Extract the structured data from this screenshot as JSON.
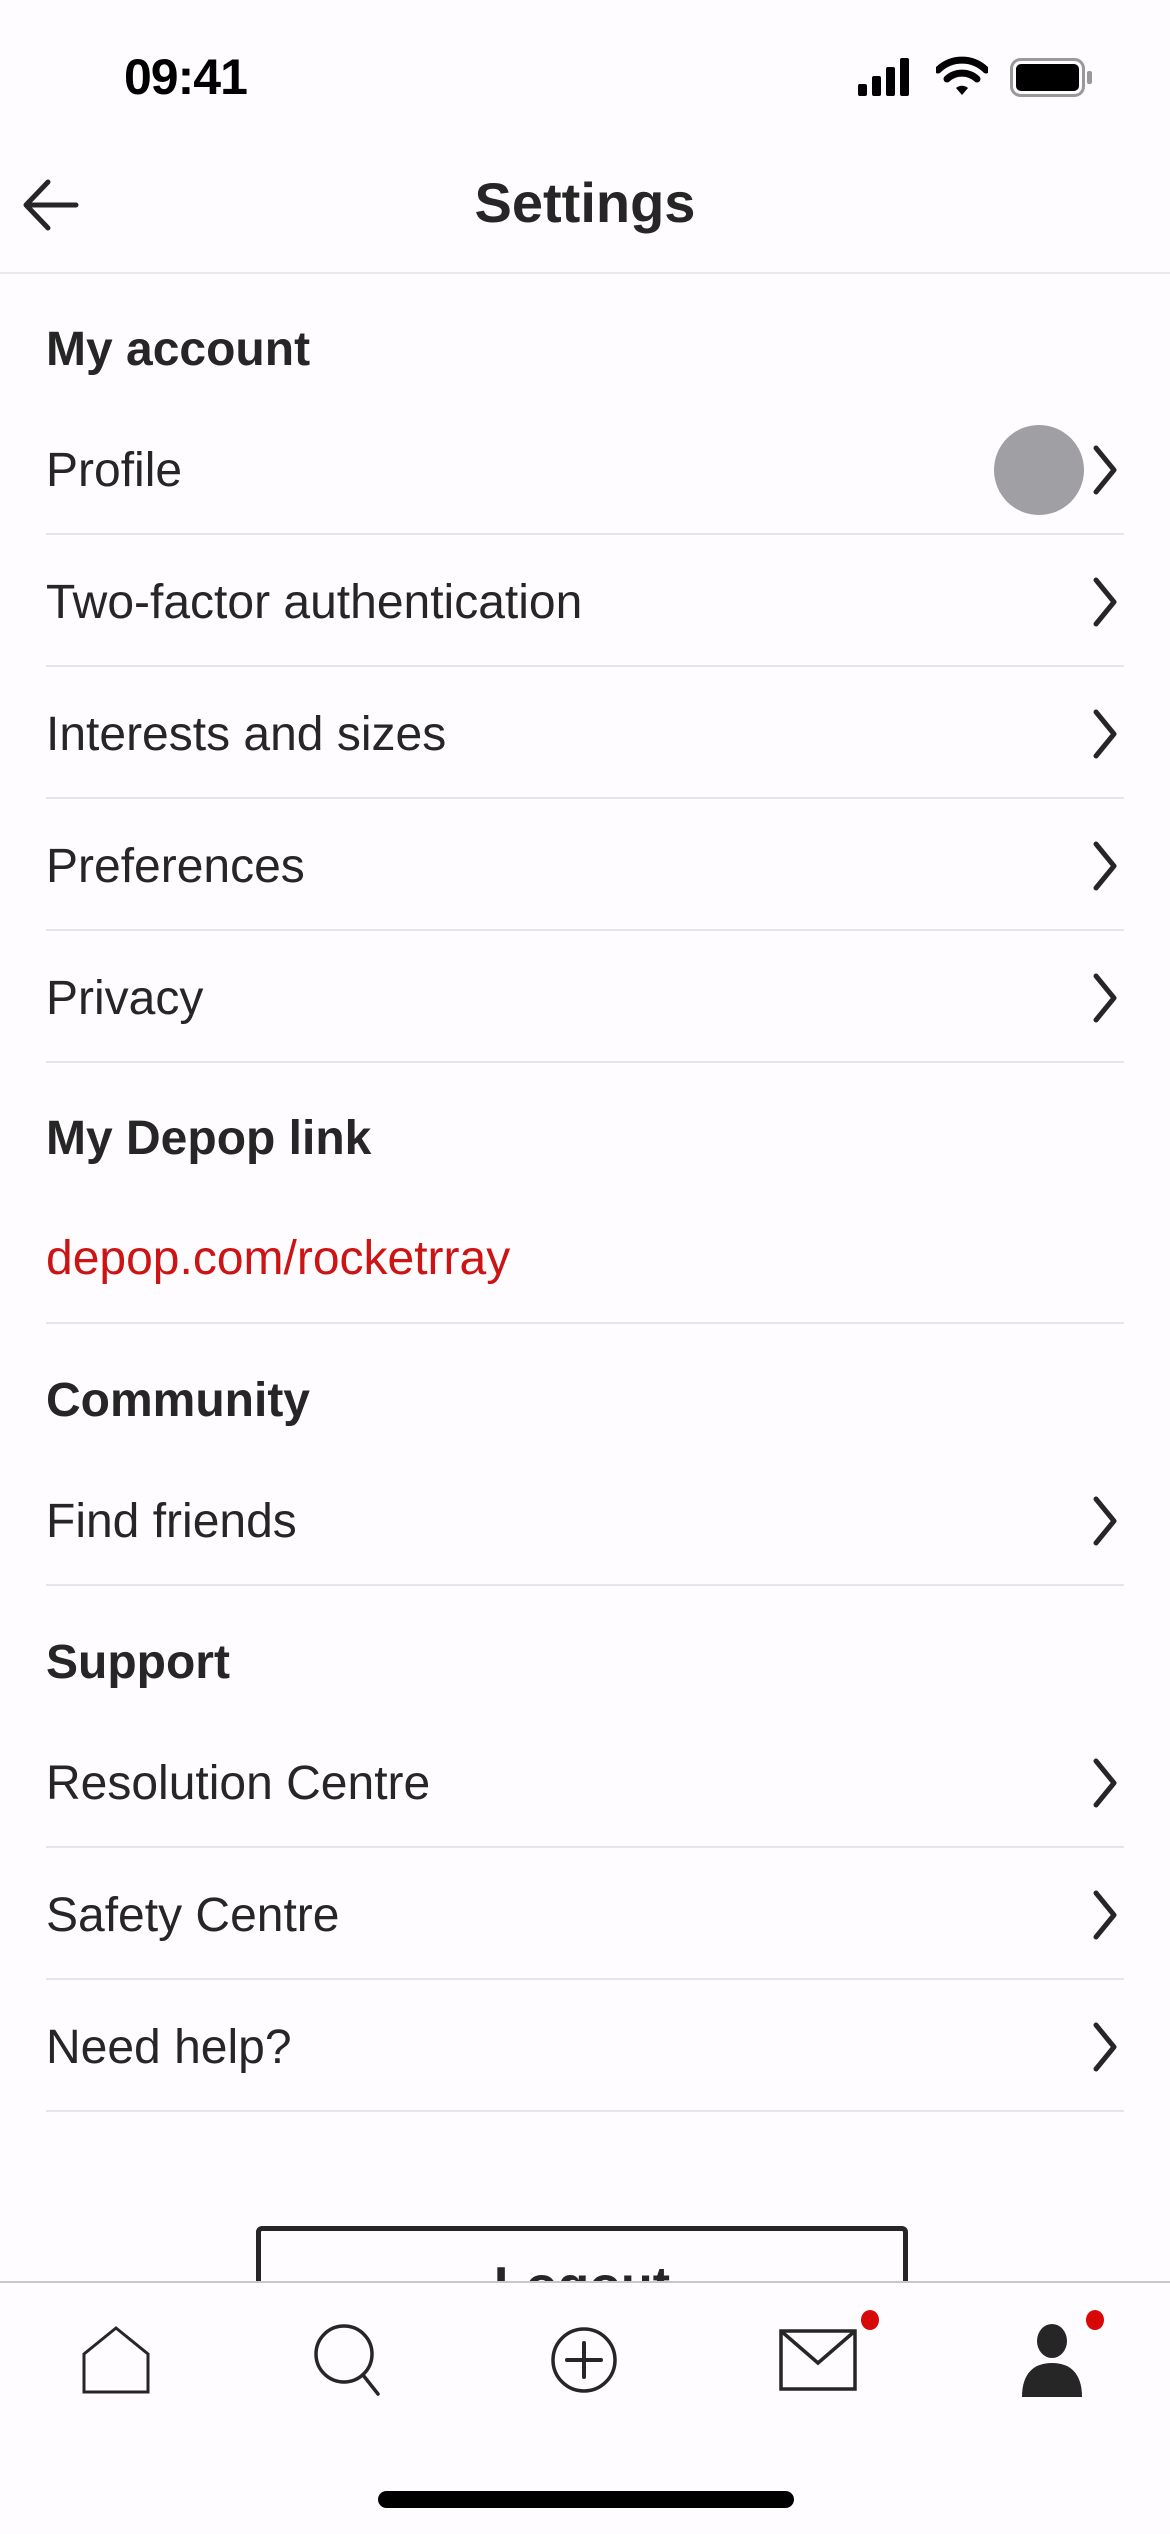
{
  "status_bar": {
    "time": "09:41",
    "icons": [
      "cellular-signal-icon",
      "wifi-icon",
      "battery-icon"
    ]
  },
  "header": {
    "title": "Settings",
    "back_icon": "arrow-left-icon"
  },
  "sections": {
    "account": {
      "title": "My account",
      "items": [
        {
          "label": "Profile",
          "has_avatar": true
        },
        {
          "label": "Two-factor authentication"
        },
        {
          "label": "Interests and sizes"
        },
        {
          "label": "Preferences"
        },
        {
          "label": "Privacy"
        }
      ]
    },
    "depop_link": {
      "title": "My Depop link",
      "link": "depop.com/rocketrray"
    },
    "community": {
      "title": "Community",
      "items": [
        {
          "label": "Find friends"
        }
      ]
    },
    "support": {
      "title": "Support",
      "items": [
        {
          "label": "Resolution Centre"
        },
        {
          "label": "Safety Centre"
        },
        {
          "label": "Need help?"
        }
      ]
    }
  },
  "logout_label": "Logout",
  "tab_bar": {
    "tabs": [
      {
        "name": "home",
        "icon": "home-icon",
        "badge": false
      },
      {
        "name": "search",
        "icon": "search-icon",
        "badge": false
      },
      {
        "name": "sell",
        "icon": "plus-circle-icon",
        "badge": false
      },
      {
        "name": "inbox",
        "icon": "mail-icon",
        "badge": true
      },
      {
        "name": "profile",
        "icon": "person-icon",
        "badge": true,
        "active": true
      }
    ]
  },
  "colors": {
    "accent": "#cc1414",
    "badge": "#d80808",
    "text": "#262626",
    "divider": "#e6e4ea"
  }
}
